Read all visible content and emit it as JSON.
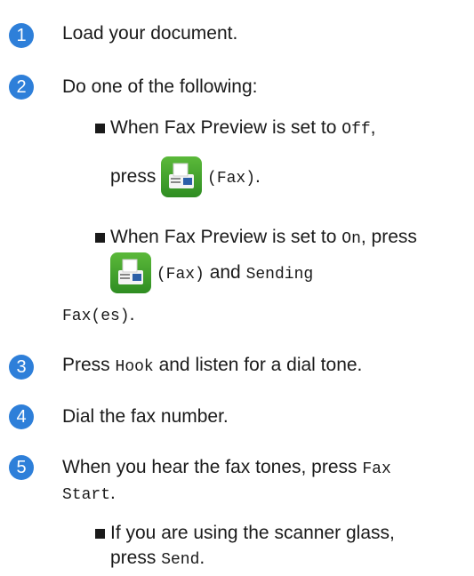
{
  "colors": {
    "step_badge": "#2e7fd9",
    "fax_icon": "#3a9d2a"
  },
  "steps": [
    {
      "number": "1",
      "text": "Load your document."
    },
    {
      "number": "2",
      "text": "Do one of the following:"
    },
    {
      "number": "3",
      "pre": "Press ",
      "code": "Hook",
      "post": " and listen for a dial tone."
    },
    {
      "number": "4",
      "text": "Dial the fax number."
    },
    {
      "number": "5",
      "pre": "When you hear the fax tones, press ",
      "code": "Fax",
      "code2": "Start",
      "post2": "."
    }
  ],
  "step2_bullets": {
    "a_pre": "When Fax Preview is set to ",
    "a_code": "Off",
    "a_post": ",",
    "a_press": "press ",
    "a_fax": "(Fax)",
    "a_end": ".",
    "b_pre": "When Fax Preview is set to ",
    "b_code": "On",
    "b_post": ", press",
    "b_fax": "(Fax)",
    "b_and": " and ",
    "b_code2": "Sending",
    "b_code3": "Fax(es)",
    "b_end": "."
  },
  "step5_bullet": {
    "pre": "If you are using the scanner glass,",
    "press": "press ",
    "code": "Send",
    "end": "."
  },
  "icons": {
    "fax": "fax-machine-icon",
    "bullet": "square-bullet-icon"
  }
}
